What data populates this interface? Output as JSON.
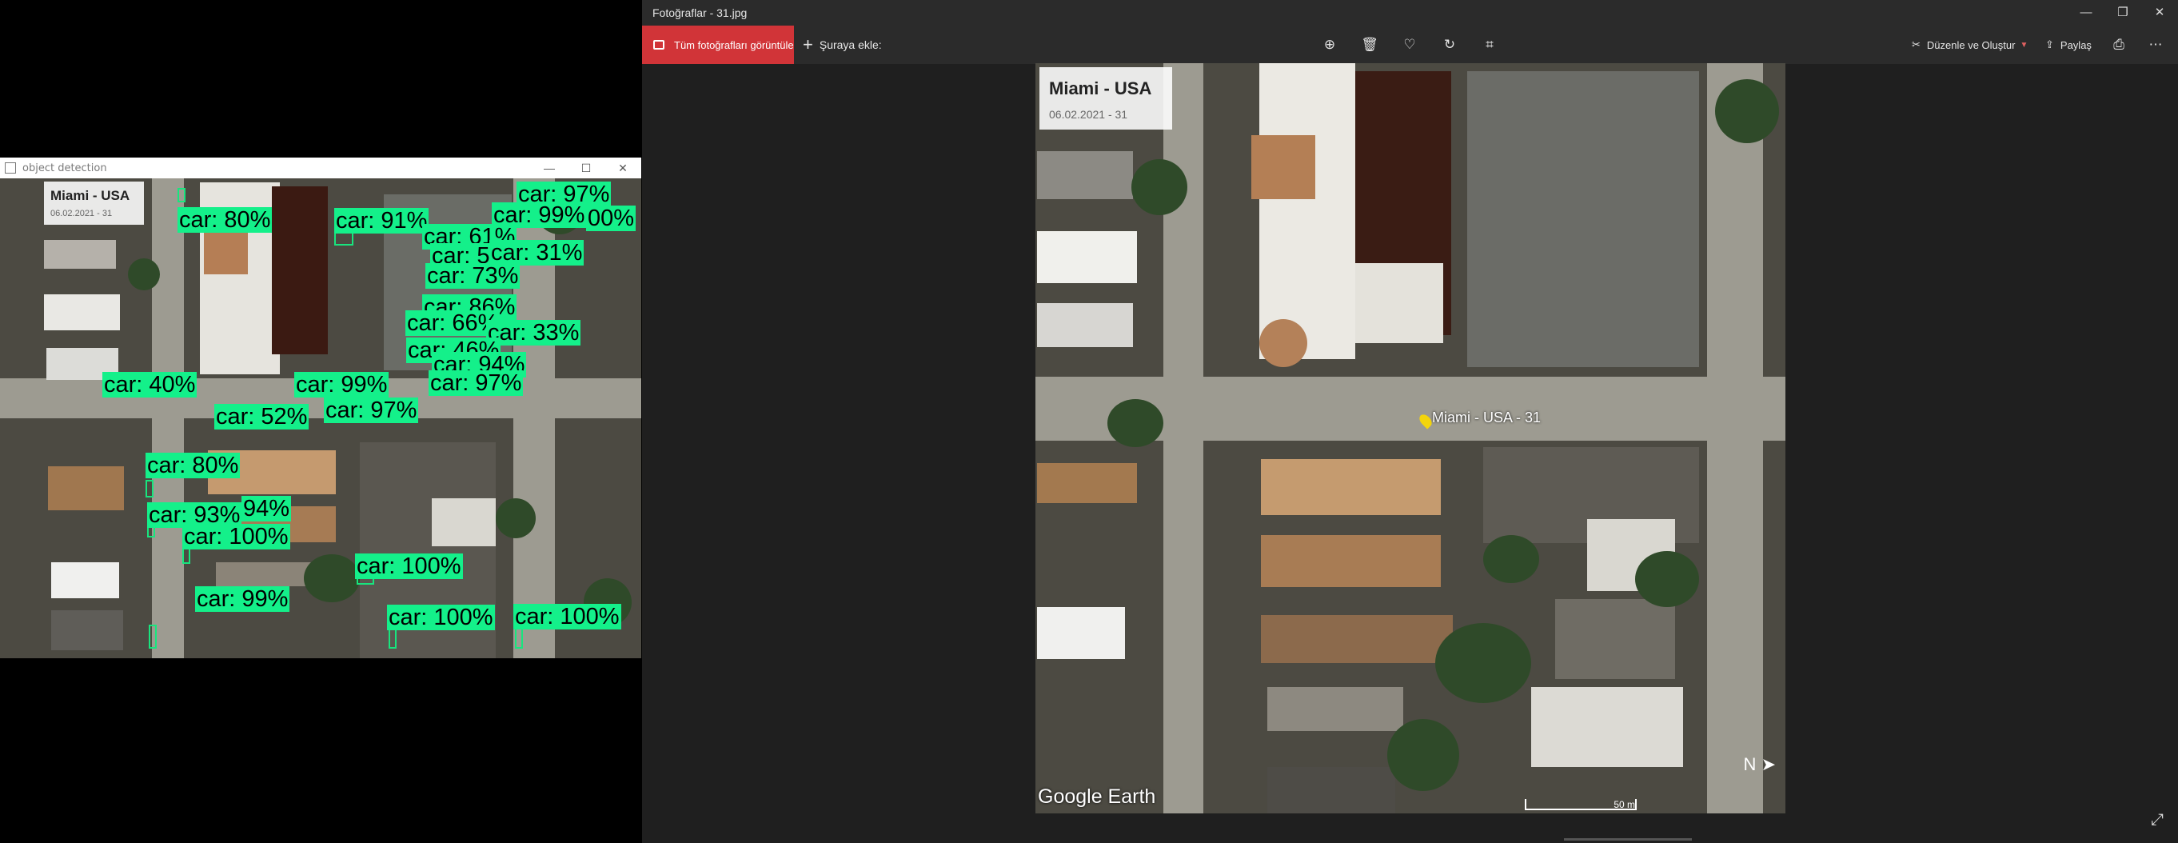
{
  "detection_window": {
    "title": "object detection",
    "stamp_title": "Miami - USA",
    "stamp_date": "06.02.2021 - 31",
    "detections": [
      {
        "label": "car: 80%"
      },
      {
        "label": "car: 91%"
      },
      {
        "label": "car: 97%"
      },
      {
        "label": "car: 99%"
      },
      {
        "label": "00%"
      },
      {
        "label": "car: 61%"
      },
      {
        "label": "car: 5"
      },
      {
        "label": "car: 31%"
      },
      {
        "label": "car: 73%"
      },
      {
        "label": "car: 86%"
      },
      {
        "label": "car: 66%"
      },
      {
        "label": "car: 33%"
      },
      {
        "label": "car: 46%"
      },
      {
        "label": "car: 94%"
      },
      {
        "label": "car: 97%"
      },
      {
        "label": "car: 40%"
      },
      {
        "label": "car: 99%"
      },
      {
        "label": "car: 52%"
      },
      {
        "label": "car: 97%"
      },
      {
        "label": "car: 80%"
      },
      {
        "label": "car: 93%"
      },
      {
        "label": "94%"
      },
      {
        "label": "car: 100%"
      },
      {
        "label": "car: 100%"
      },
      {
        "label": "car: 99%"
      },
      {
        "label": "car: 100%"
      },
      {
        "label": "car: 100%"
      }
    ]
  },
  "photos_app": {
    "title": "Fotoğraflar - 31.jpg",
    "toolbar": {
      "all_photos": "Tüm fotoğrafları görüntüle",
      "add_to": "Şuraya ekle:",
      "edit_create": "Düzenle ve Oluştur",
      "share": "Paylaş",
      "icons": [
        "zoom-icon",
        "delete-icon",
        "favorite-icon",
        "rotate-icon",
        "crop-icon",
        "print-icon",
        "more-icon"
      ]
    },
    "photo": {
      "stamp_title": "Miami - USA",
      "stamp_date": "06.02.2021 - 31",
      "pin_label": "Miami - USA - 31",
      "logo": "Google Earth",
      "scale": "50 m",
      "north": "N"
    }
  },
  "colors": {
    "detection_box": "#18e57e",
    "accent_red": "#d13438",
    "app_background": "#1f1f1f",
    "toolbar": "#2b2b2b"
  }
}
